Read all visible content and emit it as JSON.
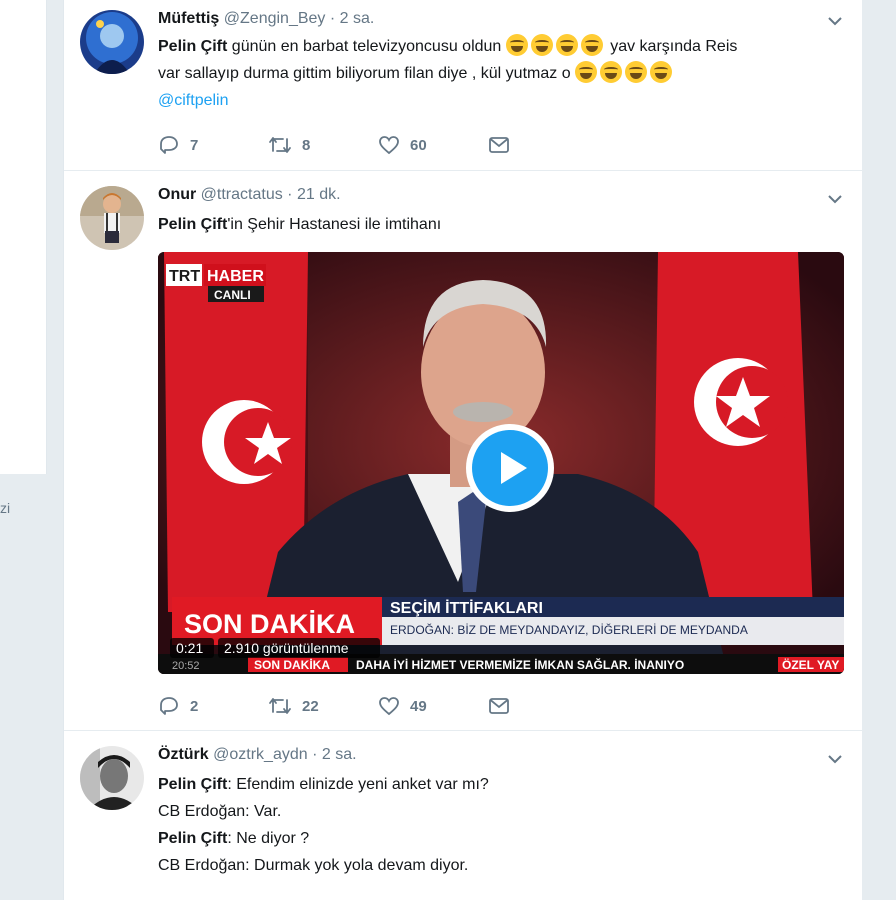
{
  "left_fragment": "zi",
  "tweets": [
    {
      "name": "Müfettiş",
      "handle": "@Zengin_Bey",
      "time": "2 sa.",
      "mention": "Pelin Çift",
      "text_a": " günün en barbat televizyoncusu oldun ",
      "text_b": " yav karşında Reis",
      "line2": "var sallayıp durma gittim biliyorum filan diye , kül yutmaz o ",
      "link": "@ciftpelin",
      "reply_count": "7",
      "retweet_count": "8",
      "like_count": "60"
    },
    {
      "name": "Onur",
      "handle": "@ttractatus",
      "time": "21 dk.",
      "mention": "Pelin Çift",
      "text": "'in Şehir Hastanesi ile imtihanı",
      "reply_count": "2",
      "retweet_count": "22",
      "like_count": "49",
      "video": {
        "channel_a": "TRT",
        "channel_b": "HABER",
        "live": "CANLI",
        "breaking": "SON DAKİKA",
        "headline": "SEÇİM İTTİFAKLARI",
        "subline": "ERDOĞAN: BİZ DE MEYDANDAYIZ, DİĞERLERİ DE MEYDANDA",
        "ticker_tag": "SON DAKİKA",
        "ticker_text": "DAHA İYİ HİZMET VERMEMİZE İMKAN SAĞLAR. İNANIYO",
        "ticker_tag2": "ÖZEL YAY",
        "ticker_time": "20:52",
        "duration": "0:21",
        "views": "2.910 görüntülenme"
      }
    },
    {
      "name": "Öztürk",
      "handle": "@oztrk_aydn",
      "time": "2 sa.",
      "l1_name": "Pelin Çift",
      "l1_text": ": Efendim elinizde yeni anket var mı?",
      "l2": "CB Erdoğan: Var.",
      "l3_name": "Pelin Çift",
      "l3_text": ": Ne diyor ?",
      "l4": "CB Erdoğan: Durmak yok yola devam diyor."
    }
  ],
  "ui": {
    "separator": "·"
  },
  "icons": [
    "reply-icon",
    "retweet-icon",
    "like-icon",
    "message-icon",
    "chevron-down-icon",
    "play-icon"
  ],
  "colors": {
    "link": "#1da1f2",
    "muted": "#657786",
    "bg": "#e6ecf0",
    "play": "#1da1f2"
  }
}
